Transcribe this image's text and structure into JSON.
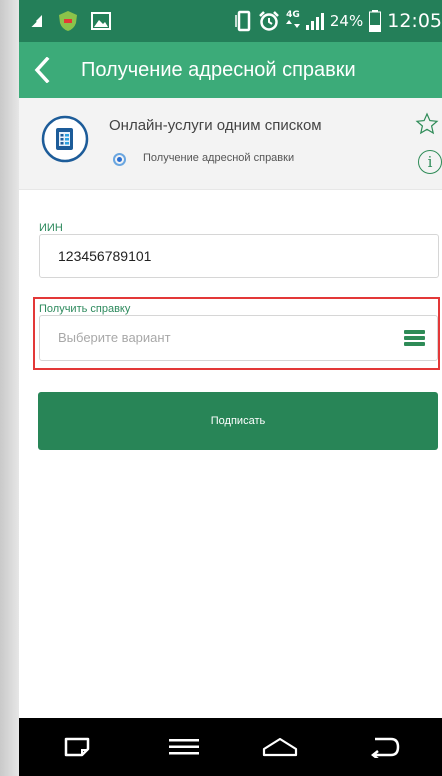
{
  "status_bar": {
    "network_type": "4G",
    "battery_percent": "24%",
    "time": "12:05"
  },
  "app_bar": {
    "title": "Получение адресной справки"
  },
  "service_card": {
    "title": "Онлайн-услуги одним списком",
    "selected_option": "Получение адресной справки",
    "info_symbol": "i"
  },
  "form": {
    "iin_label": "ИИН",
    "iin_value": "123456789101",
    "request_label": "Получить справку",
    "request_placeholder": "Выберите вариант",
    "submit_label": "Подписать"
  },
  "colors": {
    "status_bar": "#247f59",
    "app_bar": "#3cab79",
    "accent_green": "#288557",
    "highlight_red": "#e33838"
  }
}
